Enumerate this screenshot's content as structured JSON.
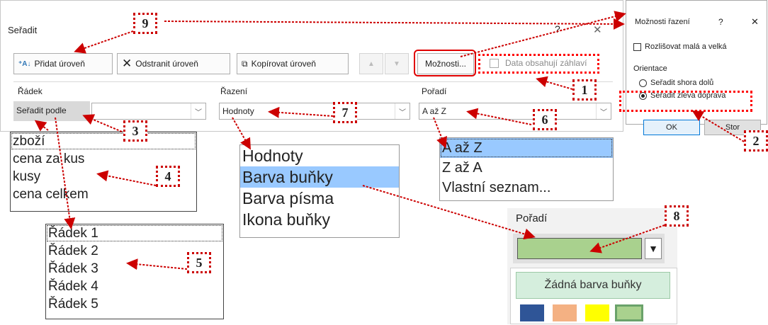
{
  "sort_dialog": {
    "title": "Seřadit",
    "help": "?",
    "close": "✕",
    "toolbar": {
      "add_level": "Přidat úroveň",
      "delete_level": "Odstranit úroveň",
      "copy_level": "Kopírovat úroveň",
      "options": "Možnosti...",
      "has_headers": "Data obsahují záhlaví"
    },
    "columns": {
      "row": "Řádek",
      "sort_on": "Řazení",
      "order": "Pořadí"
    },
    "level": {
      "label": "Seřadit podle",
      "row_value": "",
      "sort_on_value": "Hodnoty",
      "order_value": "A až Z"
    }
  },
  "row_dropdown_products": [
    "zboží",
    "cena za kus",
    "kusy",
    "cena celkem"
  ],
  "row_dropdown_rows": [
    "Řádek 1",
    "Řádek 2",
    "Řádek 3",
    "Řádek 4",
    "Řádek 5"
  ],
  "sort_on_dropdown": [
    "Hodnoty",
    "Barva buňky",
    "Barva písma",
    "Ikona buňky"
  ],
  "order_dropdown": [
    "A až Z",
    "Z až A",
    "Vlastní seznam..."
  ],
  "color_order": {
    "header": "Pořadí",
    "selected_color": "#a9d18e",
    "no_color_label": "Žádná barva buňky",
    "swatches": [
      "#2f5597",
      "#f4b183",
      "#ffff00",
      "#a9d18e"
    ]
  },
  "options_dialog": {
    "title": "Možnosti řazení",
    "help": "?",
    "close": "✕",
    "case_sensitive": "Rozlišovat malá a velká",
    "orientation_label": "Orientace",
    "top_to_bottom": "Seřadit shora dolů",
    "left_to_right": "Seřadit zleva doprava",
    "ok": "OK",
    "cancel": "Stor"
  },
  "callouts": [
    "1",
    "2",
    "3",
    "4",
    "5",
    "6",
    "7",
    "8",
    "9"
  ],
  "colors": {
    "selection": "#99c9ff",
    "callout": "#cc0000"
  }
}
